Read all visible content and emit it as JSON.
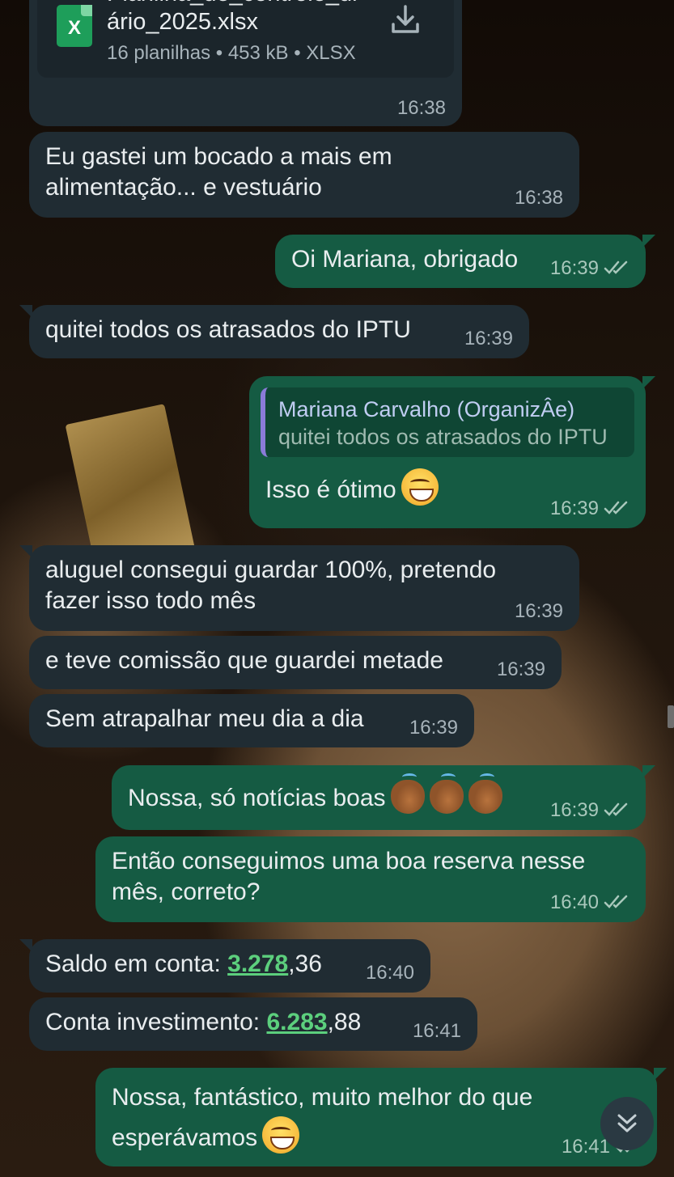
{
  "file_message": {
    "name_line1": "Planilha_de_controle_di",
    "name_line2": "ário_2025.xlsx",
    "meta": "16 planilhas • 453 kB • XLSX",
    "icon_letter": "X",
    "time": "16:38"
  },
  "messages": [
    {
      "text": "Eu gastei um bocado a mais em",
      "text2": "alimentação... e vestuário",
      "time": "16:38"
    },
    {
      "text": "Oi Mariana, obrigado",
      "time": "16:39"
    },
    {
      "text": "quitei todos os atrasados do IPTU",
      "time": "16:39"
    },
    {
      "quote_author": "Mariana Carvalho (OrganizÂe)",
      "quote_text": "quitei todos os atrasados do IPTU",
      "text": "Isso é ótimo",
      "time": "16:39"
    },
    {
      "text": "aluguel consegui guardar 100%, pretendo",
      "text2": "fazer isso todo mês",
      "time": "16:39"
    },
    {
      "text": "e teve comissão que guardei metade",
      "time": "16:39"
    },
    {
      "text": "Sem atrapalhar meu dia a dia",
      "time": "16:39"
    },
    {
      "text": "Nossa, só notícias boas",
      "time": "16:39"
    },
    {
      "text": "Então conseguimos uma boa reserva nesse",
      "text2": "mês, correto?",
      "time": "16:40"
    },
    {
      "prefix": "Saldo em conta: ",
      "link": "3.278",
      "suffix": ",36",
      "time": "16:40"
    },
    {
      "prefix": "Conta investimento: ",
      "link": "6.283",
      "suffix": ",88",
      "time": "16:41"
    },
    {
      "text": "Nossa, fantástico, muito melhor do que",
      "text2": "esperávamos",
      "time": "16:41"
    }
  ],
  "icons": {
    "file": "excel-file-icon",
    "download": "download-icon",
    "read_receipt": "double-check-icon",
    "scroll": "scroll-down-icon"
  },
  "colors": {
    "incoming_bubble": "#202c33",
    "outgoing_bubble": "#155b43",
    "link": "#5ccf7d"
  }
}
